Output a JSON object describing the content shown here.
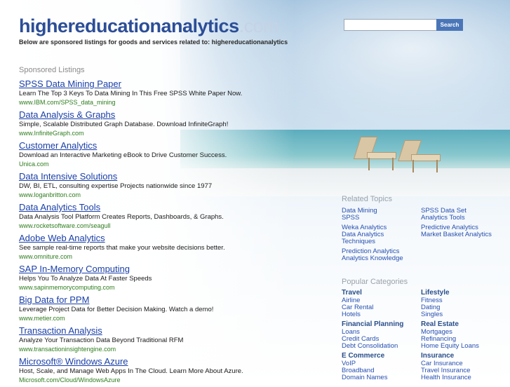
{
  "header": {
    "logo_main": "highereducationanalytics",
    "logo_tld": ".com",
    "tagline": "Below are sponsored listings for goods and services related to: highereducationanalytics"
  },
  "search": {
    "placeholder": "",
    "value": "",
    "button_label": "Search"
  },
  "sponsored": {
    "heading": "Sponsored Listings",
    "listings": [
      {
        "title": "SPSS Data Mining Paper",
        "desc": "Learn The Top 3 Keys To Data Mining In This Free SPSS White Paper Now.",
        "url": "www.IBM.com/SPSS_data_mining"
      },
      {
        "title": "Data Analysis & Graphs",
        "desc": "Simple, Scalable Distributed Graph Database. Download InfiniteGraph!",
        "url": "www.InfiniteGraph.com"
      },
      {
        "title": "Customer Analytics",
        "desc": "Download an Interactive Marketing eBook to Drive Customer Success.",
        "url": "Unica.com"
      },
      {
        "title": "Data Intensive Solutions",
        "desc": "DW, BI, ETL, consulting expertise Projects nationwide since 1977",
        "url": "www.loganbritton.com"
      },
      {
        "title": "Data Analytics Tools",
        "desc": "Data Analysis Tool Platform Creates Reports, Dashboards, & Graphs.",
        "url": "www.rocketsoftware.com/seagull"
      },
      {
        "title": "Adobe Web Analytics",
        "desc": "See sample real-time reports that make your website decisions better.",
        "url": "www.omniture.com"
      },
      {
        "title": "SAP In-Memory Computing",
        "desc": "Helps You To Analyze Data At Faster Speeds",
        "url": "www.sapinmemorycomputing.com"
      },
      {
        "title": "Big Data for PPM",
        "desc": "Leverage Project Data for Better Decision Making. Watch a demo!",
        "url": "www.metier.com"
      },
      {
        "title": "Transaction Analysis",
        "desc": "Analyze Your Transaction Data Beyond Traditional RFM",
        "url": "www.transactioninsightengine.com"
      },
      {
        "title": "Microsoft® Windows Azure",
        "desc": "Host, Scale, and Manage Web Apps In The Cloud. Learn More About Azure.",
        "url": "Microsoft.com/Cloud/WindowsAzure"
      }
    ]
  },
  "related": {
    "heading": "Related Topics",
    "left": [
      "Data Mining",
      "SPSS",
      "",
      "Weka Analytics",
      "Data Analytics Techniques",
      "",
      "Prediction Analytics",
      "Analytics Knowledge"
    ],
    "right": [
      "SPSS Data Set",
      "Analytics Tools",
      "",
      "Predictive Analytics",
      "Market Basket Analytics"
    ]
  },
  "popular": {
    "heading": "Popular Categories",
    "left": [
      {
        "title": "Travel",
        "items": [
          "Airline",
          "Car Rental",
          "Hotels"
        ]
      },
      {
        "title": "Financial Planning",
        "items": [
          "Loans",
          "Credit Cards",
          "Debt Consolidation"
        ]
      },
      {
        "title": "E Commerce",
        "items": [
          "VoIP",
          "Broadband",
          "Domain Names"
        ]
      }
    ],
    "right": [
      {
        "title": "Lifestyle",
        "items": [
          "Fitness",
          "Dating",
          "Singles"
        ]
      },
      {
        "title": "Real Estate",
        "items": [
          "Mortgages",
          "Refinancing",
          "Home Equity Loans"
        ]
      },
      {
        "title": "Insurance",
        "items": [
          "Car Insurance",
          "Travel Insurance",
          "Health Insurance"
        ]
      }
    ]
  },
  "colors": {
    "link": "#1a3fa8",
    "url": "#2e7d1e",
    "logo": "#2c4e97",
    "button": "#4a76b8"
  }
}
